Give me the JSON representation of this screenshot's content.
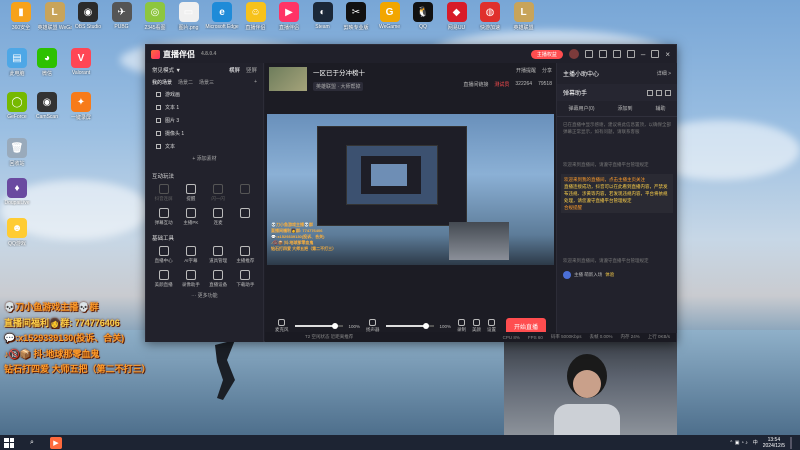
{
  "desktop": {
    "top_icons": [
      {
        "label": "360安全",
        "color": "#f7a21b",
        "glyph": "▮"
      },
      {
        "label": "英雄联盟 WeGame版",
        "color": "#c8a45a",
        "glyph": "L"
      },
      {
        "label": "OBS Studio",
        "color": "#2b2b2b",
        "glyph": "◉"
      },
      {
        "label": "PUBG",
        "color": "#555",
        "glyph": "✈"
      },
      {
        "label": "2345看图",
        "color": "#8dc63f",
        "glyph": "◎"
      },
      {
        "label": "图片.png",
        "color": "#f0f0f0",
        "glyph": "▭"
      },
      {
        "label": "Microsoft Edge",
        "color": "#1f8bd8",
        "glyph": "e"
      },
      {
        "label": "直播伴侣",
        "color": "#f7c21b",
        "glyph": "☺"
      },
      {
        "label": "直播伴侣",
        "color": "#ff3366",
        "glyph": "▶"
      },
      {
        "label": "Steam",
        "color": "#1b2838",
        "glyph": "◐"
      },
      {
        "label": "剪映专业版",
        "color": "#111",
        "glyph": "✂"
      },
      {
        "label": "WeGame",
        "color": "#f2a600",
        "glyph": "G"
      },
      {
        "label": "QQ",
        "color": "#111",
        "glyph": "🐧"
      },
      {
        "label": "网易UU",
        "color": "#d81b28",
        "glyph": "◆"
      },
      {
        "label": "快游加速",
        "color": "#e0302c",
        "glyph": "◍"
      },
      {
        "label": "英雄联盟",
        "color": "#c8a45a",
        "glyph": "L"
      }
    ],
    "left_icons": [
      {
        "label": "此电脑",
        "color": "#4ea7e6",
        "glyph": "▤"
      },
      {
        "label": "微信",
        "color": "#2dc100",
        "glyph": "◕"
      },
      {
        "label": "Valorant",
        "color": "#ff4655",
        "glyph": "V"
      },
      {
        "label": "GeForce",
        "color": "#76b900",
        "glyph": "◯"
      },
      {
        "label": "CamScan",
        "color": "#333",
        "glyph": "◉"
      },
      {
        "label": "一键录屏",
        "color": "#f77b1a",
        "glyph": "✦"
      },
      {
        "label": "回收站",
        "color": "#9ab",
        "glyph": "🗑"
      },
      {
        "label": "DoupaiLive",
        "color": "#6a4aa0",
        "glyph": "♦"
      },
      {
        "label": "QQ游戏",
        "color": "#ffcc33",
        "glyph": "☻"
      }
    ],
    "overlay_lines": [
      "💀刀小鱼游戏主播💀群",
      "直播间福利👩群: 774776406",
      "💬:x1529339130(投诉、合关)",
      "♪🔞📦 抖:地球那零血鬼",
      "钻石打四爱  大师五把（第二不打三）"
    ]
  },
  "app": {
    "name": "直播伴侣",
    "version": "4.8.0.4",
    "title_pill": "主播权益",
    "left": {
      "scene_label": "常见模式 ▼",
      "scene_tabs": [
        "横屏",
        "竖屏"
      ],
      "source_tabs": [
        "我的场景",
        "场景二",
        "场景三"
      ],
      "sources": [
        "游戏画",
        "文本 1",
        "图片 3",
        "摄像头 1",
        "文本"
      ],
      "add_source": "+ 添加素材",
      "interact_label": "互动玩法",
      "interact_tools": [
        "抖音连屏",
        "提醒",
        "闪一闪"
      ],
      "interact_tools2": [
        "弹幕互动",
        "主播PK",
        "连麦"
      ],
      "tools_label": "基础工具",
      "basic_tools_row1": [
        "直播中心",
        "AI字幕",
        "道具管理",
        "主播推荐"
      ],
      "basic_tools_row2": [
        "美颜直播",
        "录像助手",
        "直播设备",
        "下载助手"
      ],
      "more_tools": "··· 更多功能"
    },
    "center": {
      "room_title": "一区已于分冲榜十",
      "room_category": "英雄联盟 · 大师帮掉",
      "actions": [
        "开播提醒",
        "分享"
      ],
      "stats": [
        "直播间链接",
        "测试员",
        "322264",
        "79518"
      ],
      "mic_label": "麦克风",
      "mic_volume": "100%",
      "speaker_label": "扬声器",
      "speaker_volume": "100%",
      "extra_ctrls": [
        "录制",
        "美颜",
        "设置"
      ],
      "start_button": "开始直播",
      "status": [
        "CPU 8%",
        "FPS 60",
        "码率 5000Kbps",
        "丢帧 0.00%",
        "内存 24%",
        "上行 0KB/s"
      ],
      "hint": "T2 空闲状态 近距离推荐"
    },
    "right": {
      "header": "主播小助中心",
      "header_more": "详细 >",
      "assistant": "弹幕助手",
      "tabs": [
        "弹幕用户(0)",
        "添加到",
        "辅助"
      ],
      "intro": "已在直播中显示感谢，建议将此信息置顶，以确保全部弹幕正常显示，如有问题，请联系客服",
      "notice": "欢迎来到直播间，请遵守直播平台管理规定",
      "hl_title": "欢迎来到我的直播间，点击主播主页关注",
      "hl_body": "直播连接成功，抖音可以在此看到直播内容，严禁发布违规、涉黄等内容，若发现违规内容，平台将依规处理，请您遵守直播平台管理规定",
      "hl_tag": "合规提醒",
      "chat_line": "主播 萌新入场",
      "chat_user": "体验"
    }
  },
  "taskbar": {
    "time": "13:54",
    "date": "2024/12/5",
    "lang": "中"
  }
}
